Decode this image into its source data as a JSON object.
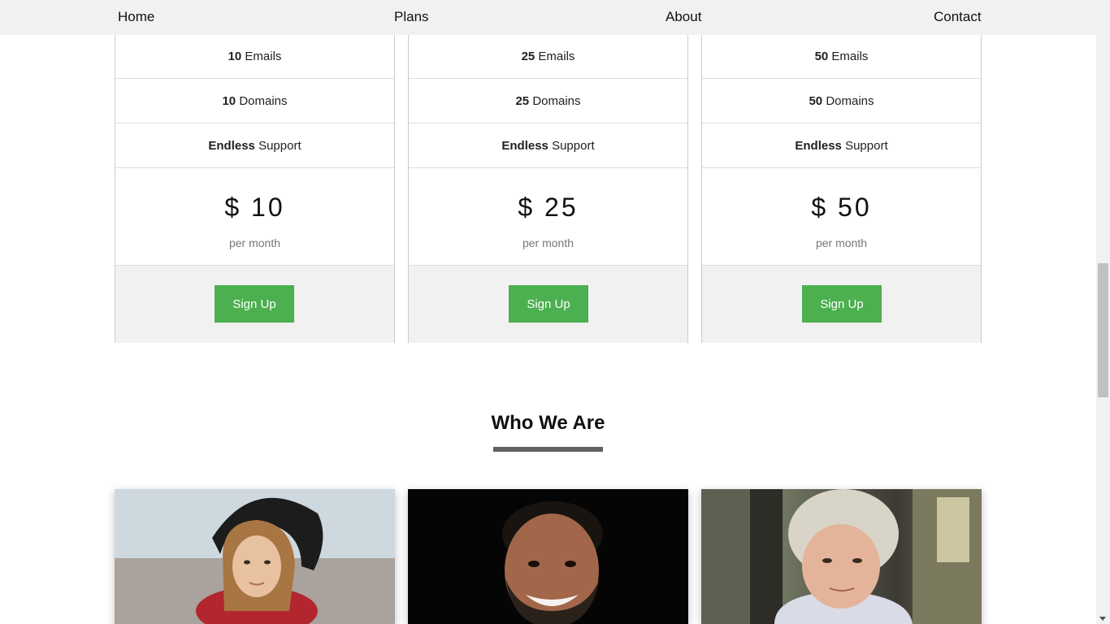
{
  "nav": {
    "home": "Home",
    "plans": "Plans",
    "about": "About",
    "contact": "Contact"
  },
  "plans": [
    {
      "emails_count": "10",
      "emails_label": " Emails",
      "domains_count": "10",
      "domains_label": " Domains",
      "support_strong": "Endless",
      "support_label": " Support",
      "price": "$ 10",
      "period": "per month",
      "cta": "Sign Up"
    },
    {
      "emails_count": "25",
      "emails_label": " Emails",
      "domains_count": "25",
      "domains_label": " Domains",
      "support_strong": "Endless",
      "support_label": " Support",
      "price": "$ 25",
      "period": "per month",
      "cta": "Sign Up"
    },
    {
      "emails_count": "50",
      "emails_label": " Emails",
      "domains_count": "50",
      "domains_label": " Domains",
      "support_strong": "Endless",
      "support_label": " Support",
      "price": "$ 50",
      "period": "per month",
      "cta": "Sign Up"
    }
  ],
  "team_section": {
    "title": "Who We Are"
  },
  "colors": {
    "accent_green": "#4caf50",
    "nav_bg": "#f1f1f1",
    "underline": "#616161"
  }
}
